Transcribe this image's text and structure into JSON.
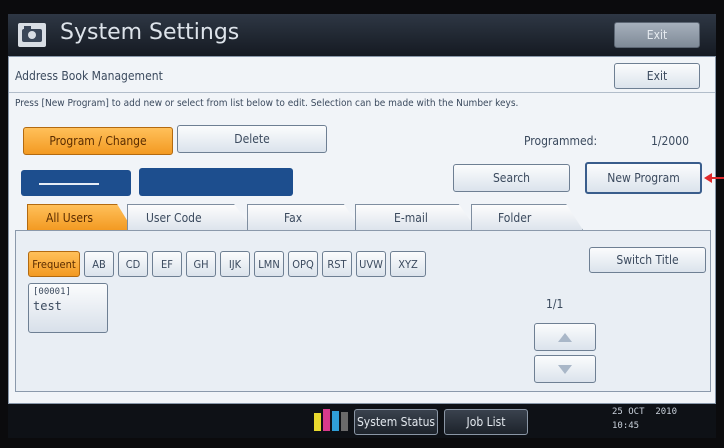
{
  "title_bar": {
    "title": "System Settings",
    "exit_label": "Exit"
  },
  "panel": {
    "heading": "Address Book Management",
    "exit_label": "Exit",
    "instruction": "Press [New Program] to add new or select from list below to edit. Selection can be made with the Number keys."
  },
  "toolbar": {
    "program_change_label": "Program / Change",
    "delete_label": "Delete",
    "programmed_label": "Programmed:",
    "programmed_value": "1/2000"
  },
  "search": {
    "search_label": "Search",
    "new_program_label": "New Program"
  },
  "tabs": [
    {
      "label": "All Users",
      "selected": true
    },
    {
      "label": "User Code",
      "selected": false
    },
    {
      "label": "Fax",
      "selected": false
    },
    {
      "label": "E-mail",
      "selected": false
    },
    {
      "label": "Folder",
      "selected": false
    }
  ],
  "index_keys": [
    "Frequent",
    "AB",
    "CD",
    "EF",
    "GH",
    "IJK",
    "LMN",
    "OPQ",
    "RST",
    "UVW",
    "XYZ"
  ],
  "switch_title_label": "Switch Title",
  "entries": [
    {
      "number": "[00001]",
      "name": "test"
    }
  ],
  "page_indicator": "1/1",
  "status_bar": {
    "system_status_label": "System Status",
    "job_list_label": "Job List",
    "date": "25 OCT  2010",
    "time": "10:45",
    "toner_colors": [
      "#e8d92e",
      "#d83a8c",
      "#2f9fd8",
      "#3a3a3a"
    ]
  },
  "colors": {
    "accent": "#f39a22",
    "header": "#1f2630",
    "panel": "#f1f4f8"
  }
}
